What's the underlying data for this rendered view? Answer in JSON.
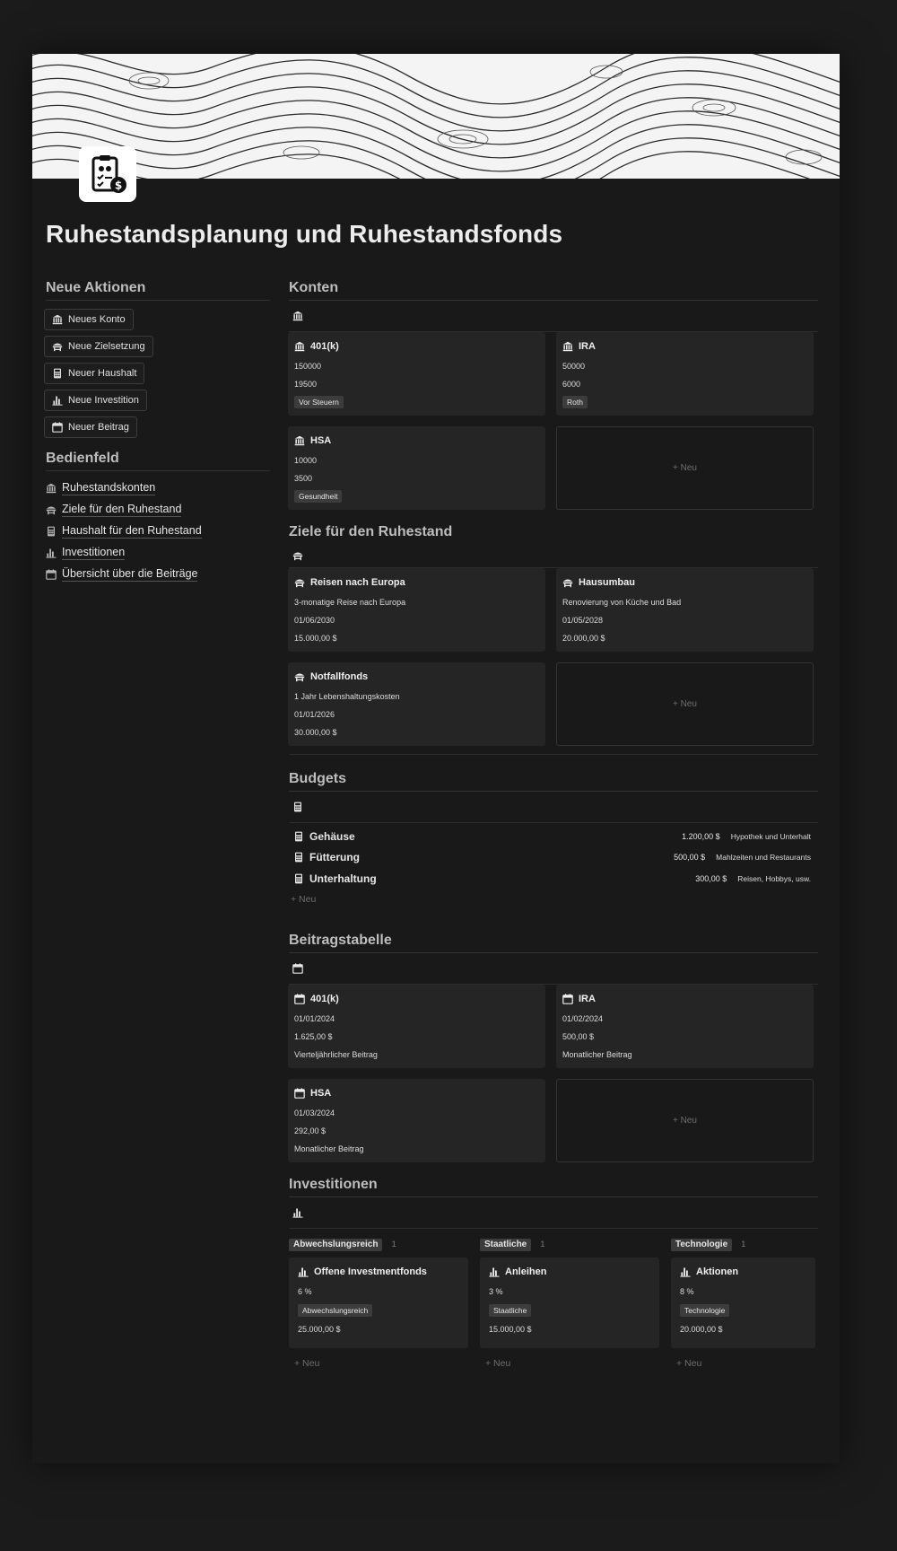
{
  "page": {
    "title": "Ruhestandsplanung und Ruhestandsfonds"
  },
  "left": {
    "actions_title": "Neue Aktionen",
    "actions": [
      {
        "label": "Neues Konto",
        "icon": "bank-icon"
      },
      {
        "label": "Neue Zielsetzung",
        "icon": "beach-chair-icon"
      },
      {
        "label": "Neuer Haushalt",
        "icon": "calculator-icon"
      },
      {
        "label": "Neue Investition",
        "icon": "bar-chart-icon"
      },
      {
        "label": "Neuer Beitrag",
        "icon": "calendar-icon"
      }
    ],
    "dashboard_title": "Bedienfeld",
    "nav": [
      {
        "label": "Ruhestandskonten",
        "icon": "bank-icon"
      },
      {
        "label": "Ziele für den Ruhestand",
        "icon": "beach-chair-icon"
      },
      {
        "label": "Haushalt für den Ruhestand",
        "icon": "calculator-icon"
      },
      {
        "label": "Investitionen",
        "icon": "bar-chart-icon"
      },
      {
        "label": "Übersicht über die Beiträge",
        "icon": "calendar-icon"
      }
    ]
  },
  "accounts": {
    "title": "Konten",
    "cards": [
      {
        "name": "401(k)",
        "balance": "150000",
        "contribution": "19500",
        "tag": "Vor Steuern"
      },
      {
        "name": "IRA",
        "balance": "50000",
        "contribution": "6000",
        "tag": "Roth"
      },
      {
        "name": "HSA",
        "balance": "10000",
        "contribution": "3500",
        "tag": "Gesundheit"
      }
    ],
    "new_label": "+ Neu"
  },
  "goals": {
    "title": "Ziele für den Ruhestand",
    "cards": [
      {
        "name": "Reisen nach Europa",
        "desc": "3-monatige Reise nach Europa",
        "date": "01/06/2030",
        "amount": "15.000,00 $"
      },
      {
        "name": "Hausumbau",
        "desc": "Renovierung von Küche und Bad",
        "date": "01/05/2028",
        "amount": "20.000,00 $"
      },
      {
        "name": "Notfallfonds",
        "desc": "1 Jahr Lebenshaltungskosten",
        "date": "01/01/2026",
        "amount": "30.000,00 $"
      }
    ],
    "new_label": "+ Neu"
  },
  "budgets": {
    "title": "Budgets",
    "rows": [
      {
        "name": "Gehäuse",
        "amount": "1.200,00 $",
        "note": "Hypothek und Unterhalt"
      },
      {
        "name": "Fütterung",
        "amount": "500,00 $",
        "note": "Mahlzeiten und Restaurants"
      },
      {
        "name": "Unterhaltung",
        "amount": "300,00 $",
        "note": "Reisen, Hobbys, usw."
      }
    ],
    "new_label": "+ Neu"
  },
  "contributions": {
    "title": "Beitragstabelle",
    "cards": [
      {
        "name": "401(k)",
        "date": "01/01/2024",
        "amount": "1.625,00 $",
        "freq": "Vierteljährlicher Beitrag"
      },
      {
        "name": "IRA",
        "date": "01/02/2024",
        "amount": "500,00 $",
        "freq": "Monatlicher Beitrag"
      },
      {
        "name": "HSA",
        "date": "01/03/2024",
        "amount": "292,00 $",
        "freq": "Monatlicher Beitrag"
      }
    ],
    "new_label": "+ Neu"
  },
  "investments": {
    "title": "Investitionen",
    "groups": [
      {
        "group": "Abwechslungsreich",
        "count": "1",
        "card": {
          "name": "Offene Investmentfonds",
          "rate": "6 %",
          "tag": "Abwechslungsreich",
          "amount": "25.000,00 $"
        }
      },
      {
        "group": "Staatliche",
        "count": "1",
        "card": {
          "name": "Anleihen",
          "rate": "3 %",
          "tag": "Staatliche",
          "amount": "15.000,00 $"
        }
      },
      {
        "group": "Technologie",
        "count": "1",
        "card": {
          "name": "Aktionen",
          "rate": "8 %",
          "tag": "Technologie",
          "amount": "20.000,00 $"
        }
      }
    ],
    "new_label": "+ Neu"
  }
}
